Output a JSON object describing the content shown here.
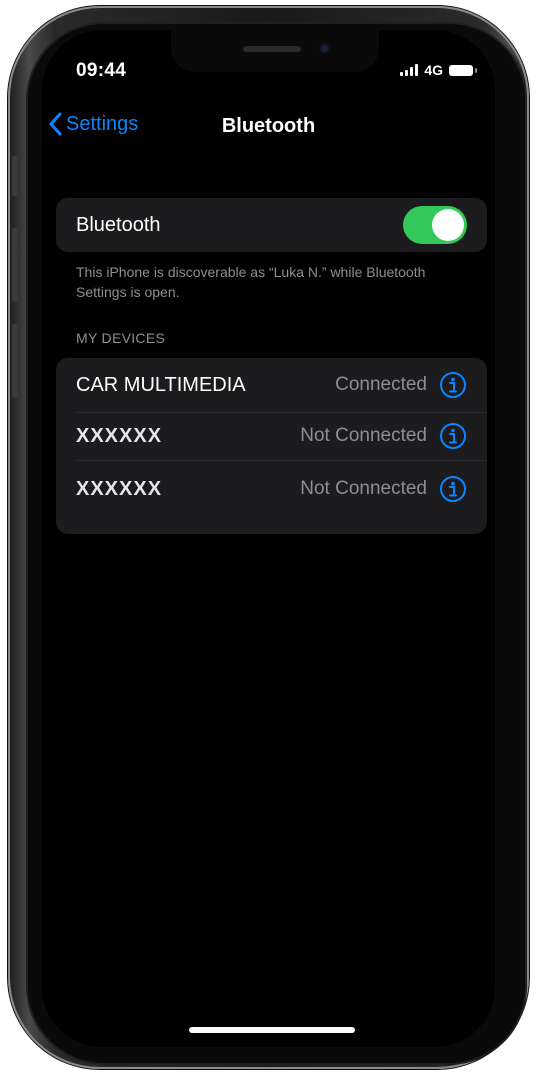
{
  "status_bar": {
    "time": "09:44",
    "network": "4G",
    "icons": [
      "signal-icon",
      "battery-icon"
    ]
  },
  "nav": {
    "back_label": "Settings",
    "title": "Bluetooth"
  },
  "bluetooth_toggle": {
    "label": "Bluetooth",
    "on": true,
    "color": "#34c759"
  },
  "discoverable_note": "This iPhone is discoverable as “Luka N.” while Bluetooth Settings is open.",
  "my_devices": {
    "header": "MY DEVICES",
    "devices": [
      {
        "name": "CAR MULTIMEDIA",
        "status": "Connected"
      },
      {
        "name": "XXXXXX",
        "status": "Not Connected"
      },
      {
        "name": "XXXXXX",
        "status": "Not Connected"
      }
    ]
  },
  "colors": {
    "accent": "#0a84ff",
    "background": "#000000",
    "cell": "#1c1c1e",
    "secondary_text": "#8e8e93"
  }
}
